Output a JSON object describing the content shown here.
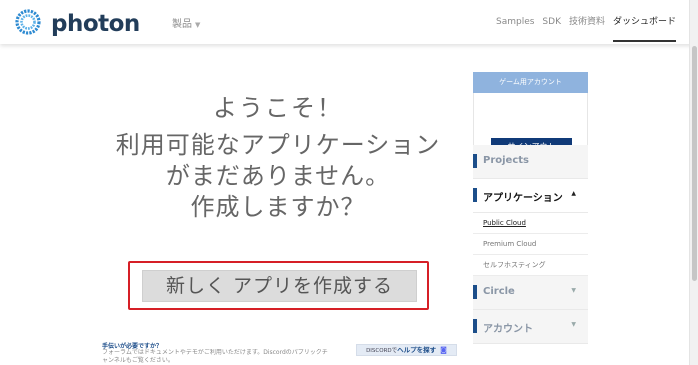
{
  "brand": {
    "name": "photon"
  },
  "nav": {
    "products": "製品",
    "links": [
      "Samples",
      "SDK",
      "技術資料",
      "ダッシュボード"
    ]
  },
  "main": {
    "welcome": "ようこそ！",
    "no_app_lines": [
      "利用可能なアプリケーション",
      "がまだありません。",
      "作成しますか？"
    ],
    "create_button": "新しく アプリを作成する"
  },
  "help": {
    "title": "手伝いが必要ですか？",
    "text_line1": "フォーラムではドキュメントやデモがご利用いただけます。Discordのパブリックチ",
    "text_line2": "ャンネルもご覧ください。",
    "discord_prefix": "DISCORDで",
    "discord_bold": "ヘルプを探す"
  },
  "sidebar": {
    "account_header": "ゲーム用アカウント",
    "signout": "サインアウト",
    "items": {
      "projects": "Projects",
      "applications": "アプリケーション",
      "public_cloud": "Public Cloud",
      "premium_cloud": "Premium Cloud",
      "self_hosting": "セルフホスティング",
      "circle": "Circle",
      "account": "アカウント"
    }
  },
  "colors": {
    "brand_dark": "#223d5a",
    "accent_blue": "#1c4e8a",
    "highlight_red": "#d61f26",
    "sidebar_header": "#8fb3de"
  }
}
